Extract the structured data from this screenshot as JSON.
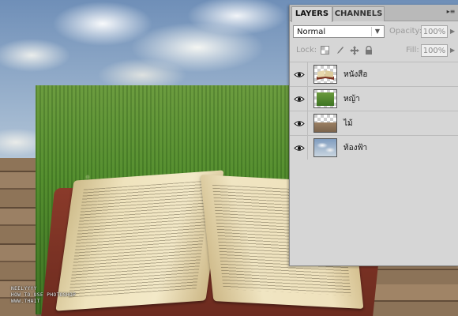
{
  "panel": {
    "tabs": [
      {
        "label": "LAYERS",
        "active": true
      },
      {
        "label": "CHANNELS",
        "active": false
      }
    ],
    "blend_mode": "Normal",
    "opacity_label": "Opacity:",
    "opacity_value": "100%",
    "lock_label": "Lock:",
    "fill_label": "Fill:",
    "fill_value": "100%",
    "layers": [
      {
        "name": "หนังสือ",
        "visible": true,
        "thumb": "book-thumbnail"
      },
      {
        "name": "หญ้า",
        "visible": true,
        "thumb": "grass-thumbnail"
      },
      {
        "name": "ไม้",
        "visible": true,
        "thumb": "wood-thumbnail"
      },
      {
        "name": "ท้องฟ้า",
        "visible": true,
        "thumb": "sky-thumbnail"
      }
    ]
  },
  "watermark": {
    "line1": "NEELYYYY",
    "line2": "HOW TO USE PHOTOSHOP",
    "line3": "WWW.THAIT"
  },
  "colors": {
    "panel_bg": "#d6d6d6",
    "tabbar_bg": "#b9b9b9",
    "grass": "#4f8a2b",
    "book_cover": "#7a3222"
  }
}
